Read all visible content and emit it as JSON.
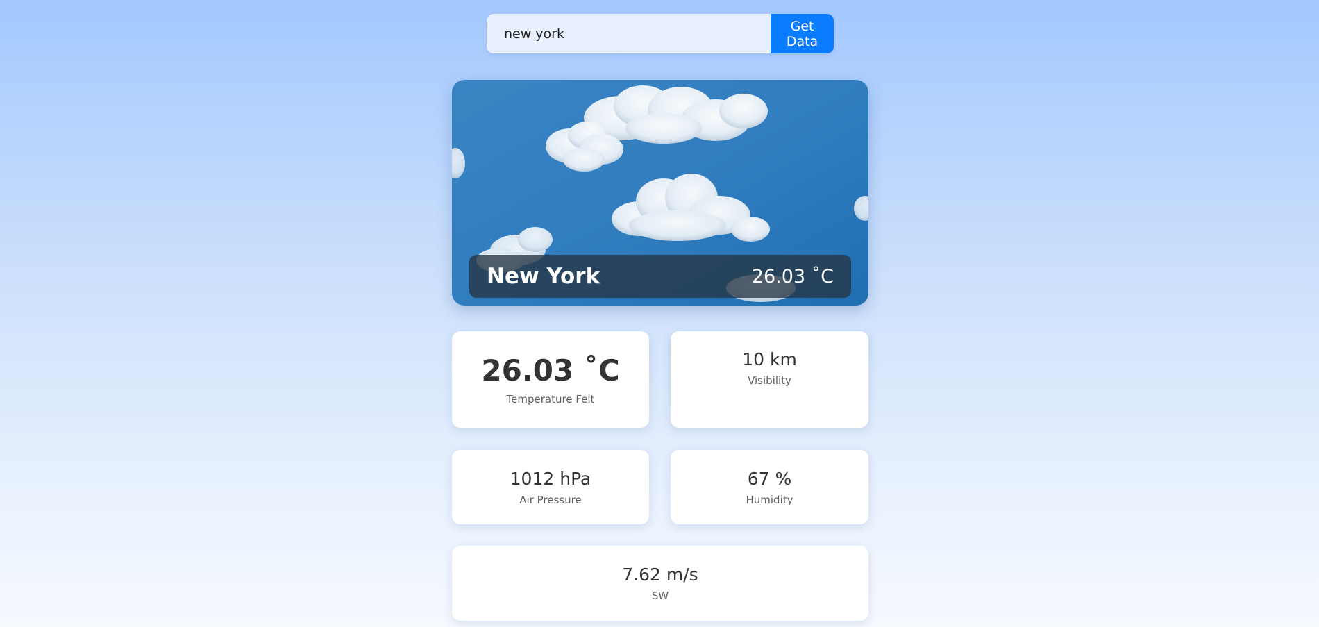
{
  "search": {
    "value": "new york",
    "button_label": "Get Data"
  },
  "hero": {
    "city": "New York",
    "temperature": "26.03 ˚C",
    "image": "sky-with-clouds"
  },
  "stats": {
    "feels_like": {
      "value": "26.03 ˚C",
      "label": "Temperature Felt"
    },
    "visibility": {
      "value": "10 km",
      "label": "Visibility"
    },
    "pressure": {
      "value": "1012 hPa",
      "label": "Air Pressure"
    },
    "humidity": {
      "value": "67 %",
      "label": "Humidity"
    },
    "wind": {
      "value": "7.62 m/s",
      "label": "SW"
    }
  },
  "colors": {
    "accent": "#0a7cff",
    "background_top": "#a3c8ff",
    "background_bottom": "#f6f9fe",
    "overlay": "#263442"
  }
}
